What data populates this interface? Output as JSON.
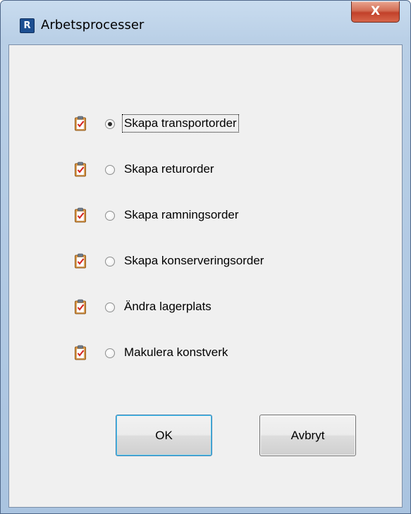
{
  "window": {
    "title": "Arbetsprocesser",
    "app_icon_letter": "R",
    "close_glyph": "X"
  },
  "options": [
    {
      "label": "Skapa transportorder",
      "checked": true,
      "icon": "clipboard-check-icon"
    },
    {
      "label": "Skapa returorder",
      "checked": false,
      "icon": "clipboard-check-icon"
    },
    {
      "label": "Skapa ramningsorder",
      "checked": false,
      "icon": "clipboard-check-icon"
    },
    {
      "label": "Skapa konserveringsorder",
      "checked": false,
      "icon": "clipboard-check-icon"
    },
    {
      "label": "Ändra lagerplats",
      "checked": false,
      "icon": "clipboard-check-icon"
    },
    {
      "label": "Makulera konstverk",
      "checked": false,
      "icon": "clipboard-check-icon"
    }
  ],
  "buttons": {
    "ok_label": "OK",
    "cancel_label": "Avbryt"
  },
  "colors": {
    "window_frame": "#aac4e0",
    "close_button": "#c2412a",
    "client_background": "#f0f0f0"
  }
}
